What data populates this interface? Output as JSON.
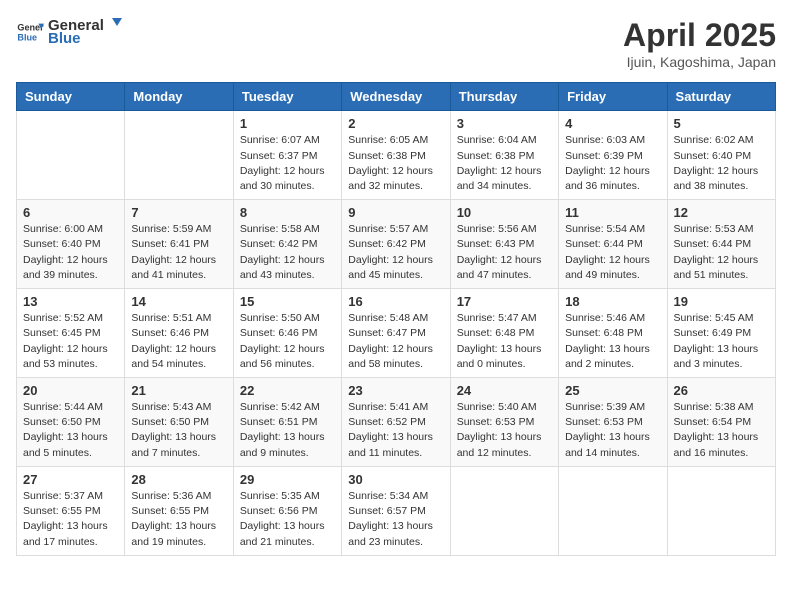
{
  "logo": {
    "general": "General",
    "blue": "Blue"
  },
  "title": "April 2025",
  "subtitle": "Ijuin, Kagoshima, Japan",
  "headers": [
    "Sunday",
    "Monday",
    "Tuesday",
    "Wednesday",
    "Thursday",
    "Friday",
    "Saturday"
  ],
  "weeks": [
    [
      {
        "day": "",
        "detail": ""
      },
      {
        "day": "",
        "detail": ""
      },
      {
        "day": "1",
        "detail": "Sunrise: 6:07 AM\nSunset: 6:37 PM\nDaylight: 12 hours\nand 30 minutes."
      },
      {
        "day": "2",
        "detail": "Sunrise: 6:05 AM\nSunset: 6:38 PM\nDaylight: 12 hours\nand 32 minutes."
      },
      {
        "day": "3",
        "detail": "Sunrise: 6:04 AM\nSunset: 6:38 PM\nDaylight: 12 hours\nand 34 minutes."
      },
      {
        "day": "4",
        "detail": "Sunrise: 6:03 AM\nSunset: 6:39 PM\nDaylight: 12 hours\nand 36 minutes."
      },
      {
        "day": "5",
        "detail": "Sunrise: 6:02 AM\nSunset: 6:40 PM\nDaylight: 12 hours\nand 38 minutes."
      }
    ],
    [
      {
        "day": "6",
        "detail": "Sunrise: 6:00 AM\nSunset: 6:40 PM\nDaylight: 12 hours\nand 39 minutes."
      },
      {
        "day": "7",
        "detail": "Sunrise: 5:59 AM\nSunset: 6:41 PM\nDaylight: 12 hours\nand 41 minutes."
      },
      {
        "day": "8",
        "detail": "Sunrise: 5:58 AM\nSunset: 6:42 PM\nDaylight: 12 hours\nand 43 minutes."
      },
      {
        "day": "9",
        "detail": "Sunrise: 5:57 AM\nSunset: 6:42 PM\nDaylight: 12 hours\nand 45 minutes."
      },
      {
        "day": "10",
        "detail": "Sunrise: 5:56 AM\nSunset: 6:43 PM\nDaylight: 12 hours\nand 47 minutes."
      },
      {
        "day": "11",
        "detail": "Sunrise: 5:54 AM\nSunset: 6:44 PM\nDaylight: 12 hours\nand 49 minutes."
      },
      {
        "day": "12",
        "detail": "Sunrise: 5:53 AM\nSunset: 6:44 PM\nDaylight: 12 hours\nand 51 minutes."
      }
    ],
    [
      {
        "day": "13",
        "detail": "Sunrise: 5:52 AM\nSunset: 6:45 PM\nDaylight: 12 hours\nand 53 minutes."
      },
      {
        "day": "14",
        "detail": "Sunrise: 5:51 AM\nSunset: 6:46 PM\nDaylight: 12 hours\nand 54 minutes."
      },
      {
        "day": "15",
        "detail": "Sunrise: 5:50 AM\nSunset: 6:46 PM\nDaylight: 12 hours\nand 56 minutes."
      },
      {
        "day": "16",
        "detail": "Sunrise: 5:48 AM\nSunset: 6:47 PM\nDaylight: 12 hours\nand 58 minutes."
      },
      {
        "day": "17",
        "detail": "Sunrise: 5:47 AM\nSunset: 6:48 PM\nDaylight: 13 hours\nand 0 minutes."
      },
      {
        "day": "18",
        "detail": "Sunrise: 5:46 AM\nSunset: 6:48 PM\nDaylight: 13 hours\nand 2 minutes."
      },
      {
        "day": "19",
        "detail": "Sunrise: 5:45 AM\nSunset: 6:49 PM\nDaylight: 13 hours\nand 3 minutes."
      }
    ],
    [
      {
        "day": "20",
        "detail": "Sunrise: 5:44 AM\nSunset: 6:50 PM\nDaylight: 13 hours\nand 5 minutes."
      },
      {
        "day": "21",
        "detail": "Sunrise: 5:43 AM\nSunset: 6:50 PM\nDaylight: 13 hours\nand 7 minutes."
      },
      {
        "day": "22",
        "detail": "Sunrise: 5:42 AM\nSunset: 6:51 PM\nDaylight: 13 hours\nand 9 minutes."
      },
      {
        "day": "23",
        "detail": "Sunrise: 5:41 AM\nSunset: 6:52 PM\nDaylight: 13 hours\nand 11 minutes."
      },
      {
        "day": "24",
        "detail": "Sunrise: 5:40 AM\nSunset: 6:53 PM\nDaylight: 13 hours\nand 12 minutes."
      },
      {
        "day": "25",
        "detail": "Sunrise: 5:39 AM\nSunset: 6:53 PM\nDaylight: 13 hours\nand 14 minutes."
      },
      {
        "day": "26",
        "detail": "Sunrise: 5:38 AM\nSunset: 6:54 PM\nDaylight: 13 hours\nand 16 minutes."
      }
    ],
    [
      {
        "day": "27",
        "detail": "Sunrise: 5:37 AM\nSunset: 6:55 PM\nDaylight: 13 hours\nand 17 minutes."
      },
      {
        "day": "28",
        "detail": "Sunrise: 5:36 AM\nSunset: 6:55 PM\nDaylight: 13 hours\nand 19 minutes."
      },
      {
        "day": "29",
        "detail": "Sunrise: 5:35 AM\nSunset: 6:56 PM\nDaylight: 13 hours\nand 21 minutes."
      },
      {
        "day": "30",
        "detail": "Sunrise: 5:34 AM\nSunset: 6:57 PM\nDaylight: 13 hours\nand 23 minutes."
      },
      {
        "day": "",
        "detail": ""
      },
      {
        "day": "",
        "detail": ""
      },
      {
        "day": "",
        "detail": ""
      }
    ]
  ]
}
